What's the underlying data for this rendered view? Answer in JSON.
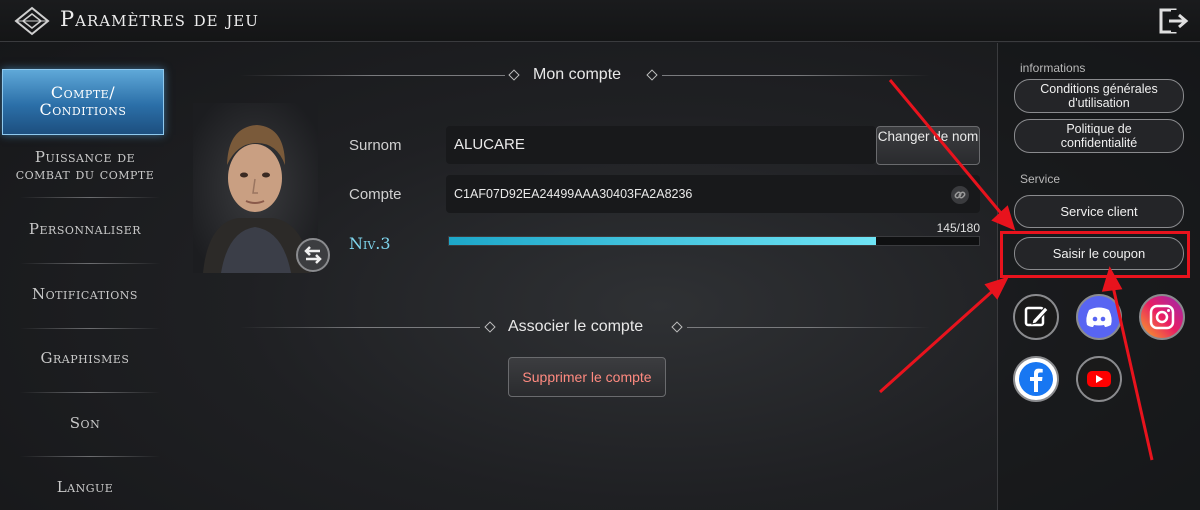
{
  "header": {
    "title": "Paramètres de jeu",
    "logo_icon": "diamond-emblem-icon",
    "exit_icon": "exit-icon"
  },
  "sidebar": {
    "items": [
      {
        "label": "Compte/\nConditions",
        "active": true
      },
      {
        "label": "Puissance de\ncombat du compte",
        "active": false
      },
      {
        "label": "Personnaliser",
        "active": false
      },
      {
        "label": "Notifications",
        "active": false
      },
      {
        "label": "Graphismes",
        "active": false
      },
      {
        "label": "Son",
        "active": false
      },
      {
        "label": "Langue",
        "active": false
      }
    ]
  },
  "account": {
    "section_title": "Mon compte",
    "nickname_label": "Surnom",
    "nickname_value": "ALUCARE",
    "rename_button": "Changer de nom",
    "account_label": "Compte",
    "account_value": "C1AF07D92EA24499AAA30403FA2A8236",
    "level_label": "Niv.3",
    "xp_text": "145/180",
    "xp_fraction": 0.806
  },
  "link_section": {
    "title": "Associer le compte",
    "delete_button": "Supprimer le compte"
  },
  "right_panel": {
    "info_label": "informations",
    "terms_button": "Conditions générales d'utilisation",
    "privacy_button": "Politique de confidentialité",
    "service_label": "Service",
    "support_button": "Service client",
    "coupon_button": "Saisir le coupon",
    "social_icons": [
      "edit-icon",
      "discord-icon",
      "instagram-icon",
      "facebook-icon",
      "youtube-icon"
    ]
  },
  "colors": {
    "accent_blue": "#2b6fa8",
    "xp_cyan": "#6fe4f5",
    "level_text": "#7fd6ee",
    "highlight_red": "#e8131d",
    "delete_text": "#ff8a80"
  }
}
